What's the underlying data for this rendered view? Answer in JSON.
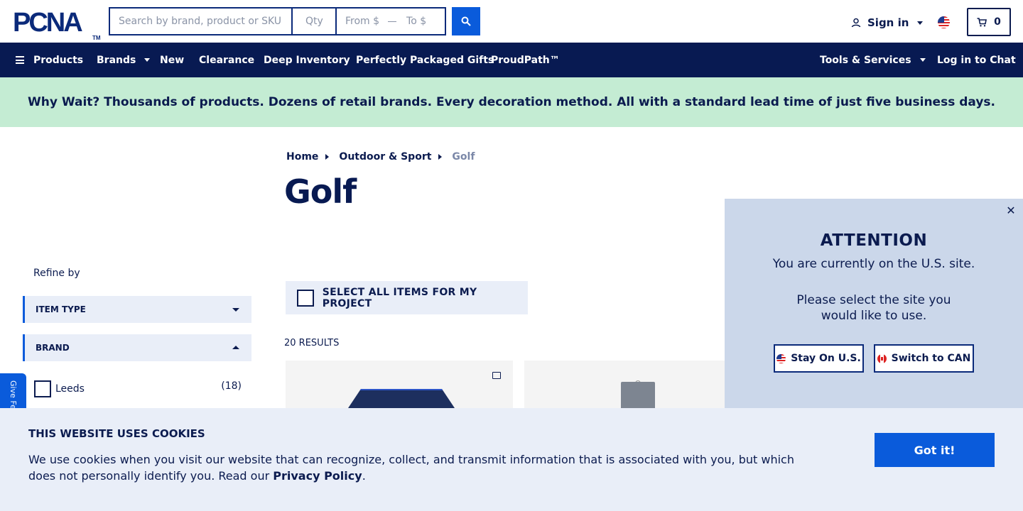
{
  "header": {
    "logo_text": "PCNA",
    "logo_tm": "TM",
    "search": {
      "placeholder": "Search by brand, product or SKU",
      "qty_placeholder": "Qty",
      "from_placeholder": "From $",
      "to_placeholder": "To $"
    },
    "signin_label": "Sign in",
    "cart_count": "0"
  },
  "nav": {
    "items": [
      {
        "label": "Products",
        "icon": "hamburger-icon"
      },
      {
        "label": "Brands",
        "dropdown": true
      },
      {
        "label": "New"
      },
      {
        "label": "Clearance"
      },
      {
        "label": "Deep Inventory"
      },
      {
        "label": "Perfectly Packaged Gifts"
      },
      {
        "label": "ProudPath™"
      },
      {
        "label": "Tools & Services",
        "dropdown": true
      },
      {
        "label": "Log in to Chat"
      }
    ]
  },
  "promo": {
    "text": "Why Wait? Thousands of products. Dozens of retail brands. Every decoration method. All with a standard lead time of just five business days."
  },
  "breadcrumb": {
    "items": [
      "Home",
      "Outdoor & Sport",
      "Golf"
    ]
  },
  "page_title": "Golf",
  "sidebar": {
    "refine_label": "Refine by",
    "facets": [
      {
        "label": "ITEM TYPE",
        "expanded": false
      },
      {
        "label": "BRAND",
        "expanded": true
      }
    ],
    "brands": [
      {
        "label": "Leeds",
        "count": "(18)"
      }
    ],
    "feedback_label": "Give Feedback"
  },
  "main": {
    "select_all_label": "SELECT ALL ITEMS FOR MY PROJECT",
    "results_label": "20 RESULTS"
  },
  "attention": {
    "title": "ATTENTION",
    "line1": "You are currently on the U.S. site.",
    "line2": "Please select the site you would like to use.",
    "stay_label": "Stay On U.S.",
    "switch_label": "Switch to CAN"
  },
  "cookie": {
    "title": "THIS WEBSITE USES COOKIES",
    "text_before": "We use cookies when you visit our website that can recognize, collect, and transmit information that is associated with you, but which does not personally identify you. Read our ",
    "link_label": "Privacy Policy",
    "text_after": ".",
    "button_label": "Got it!"
  },
  "colors": {
    "brand_navy": "#081a52",
    "accent_blue": "#0a5bdb",
    "promo_green": "#c4ecd3",
    "panel_blue": "#cbd7ea"
  }
}
